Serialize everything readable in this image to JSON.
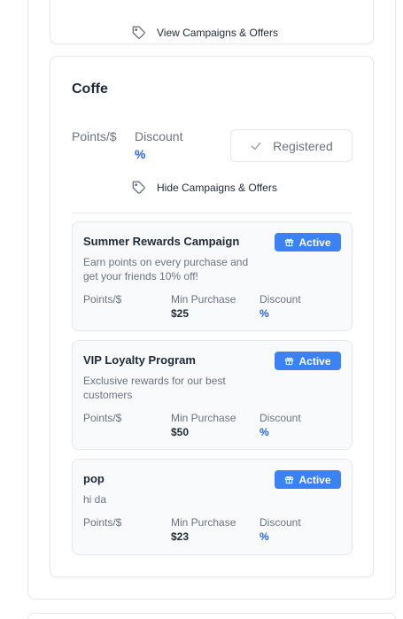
{
  "top_card": {
    "toggle_label": "View Campaigns & Offers",
    "toggle_icon": "tag-icon"
  },
  "merchant": {
    "name": "Coffe",
    "points_label": "Points/$",
    "discount_label": "Discount",
    "discount_value": "%",
    "registered_label": "Registered",
    "toggle_label": "Hide Campaigns & Offers"
  },
  "campaigns": [
    {
      "title": "Summer Rewards Campaign",
      "description": "Earn points on every purchase and get your friends 10% off!",
      "status": "Active",
      "points_label": "Points/$",
      "min_label": "Min Purchase",
      "min_value": "$25",
      "discount_label": "Discount",
      "discount_value": "%"
    },
    {
      "title": "VIP Loyalty Program",
      "description": "Exclusive rewards for our best customers",
      "status": "Active",
      "points_label": "Points/$",
      "min_label": "Min Purchase",
      "min_value": "$50",
      "discount_label": "Discount",
      "discount_value": "%"
    },
    {
      "title": "pop",
      "description": "hi da",
      "status": "Active",
      "points_label": "Points/$",
      "min_label": "Min Purchase",
      "min_value": "$23",
      "discount_label": "Discount",
      "discount_value": "%"
    }
  ],
  "colors": {
    "accent": "#3b82f6",
    "accent_text": "#2563eb",
    "border": "#e5e7eb",
    "muted_text": "#6b7280"
  }
}
